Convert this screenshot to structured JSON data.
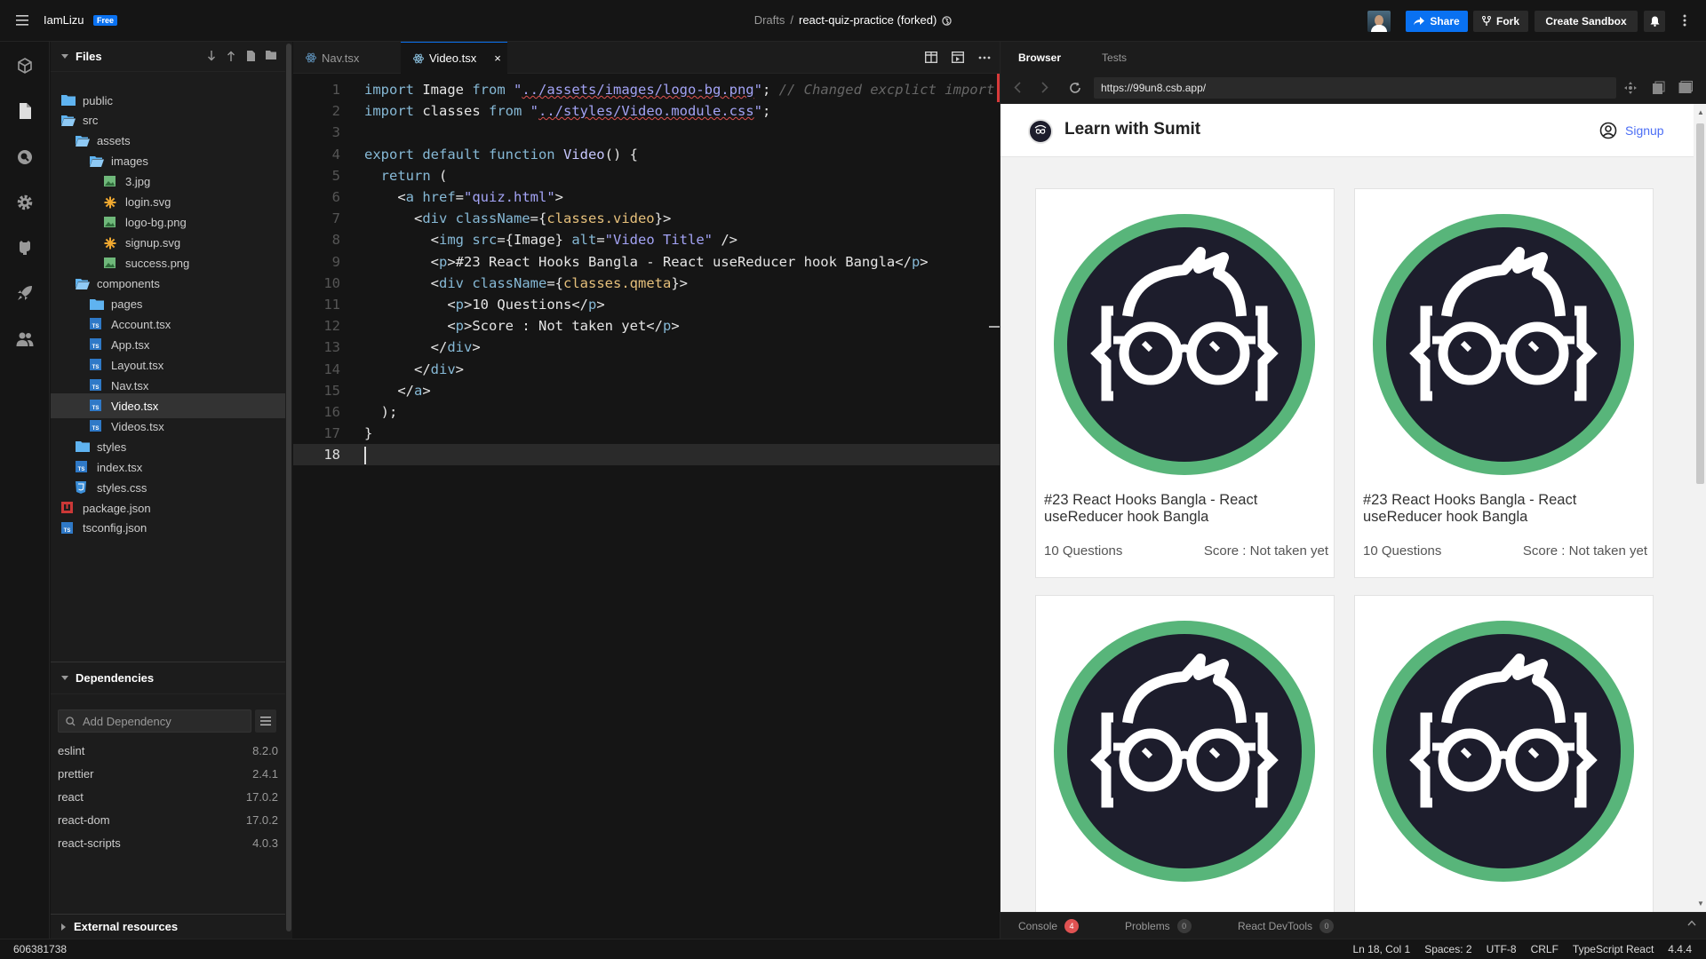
{
  "topbar": {
    "username": "IamLizu",
    "plan_badge": "Free",
    "breadcrumb": {
      "folder": "Drafts",
      "separator": "/",
      "sandbox_name": "react-quiz-practice (forked)"
    },
    "share_label": "Share",
    "fork_label": "Fork",
    "create_label": "Create Sandbox",
    "accent_color": "#0971f1"
  },
  "activity_bar": {
    "icons": [
      "cube-icon",
      "file-icon",
      "search-icon",
      "gear-icon",
      "github-icon",
      "rocket-icon",
      "users-icon"
    ]
  },
  "sidebar": {
    "files_title": "Files",
    "tree": [
      {
        "name": "public",
        "kind": "folder",
        "depth": 0
      },
      {
        "name": "src",
        "kind": "folder-open",
        "depth": 0
      },
      {
        "name": "assets",
        "kind": "folder-open",
        "depth": 1
      },
      {
        "name": "images",
        "kind": "folder-open",
        "depth": 2
      },
      {
        "name": "3.jpg",
        "kind": "image",
        "depth": 3
      },
      {
        "name": "login.svg",
        "kind": "svg",
        "depth": 3
      },
      {
        "name": "logo-bg.png",
        "kind": "image",
        "depth": 3
      },
      {
        "name": "signup.svg",
        "kind": "svg",
        "depth": 3
      },
      {
        "name": "success.png",
        "kind": "image",
        "depth": 3
      },
      {
        "name": "components",
        "kind": "folder-open",
        "depth": 1
      },
      {
        "name": "pages",
        "kind": "folder",
        "depth": 2
      },
      {
        "name": "Account.tsx",
        "kind": "ts",
        "depth": 2
      },
      {
        "name": "App.tsx",
        "kind": "ts",
        "depth": 2
      },
      {
        "name": "Layout.tsx",
        "kind": "ts",
        "depth": 2
      },
      {
        "name": "Nav.tsx",
        "kind": "ts",
        "depth": 2
      },
      {
        "name": "Video.tsx",
        "kind": "ts",
        "depth": 2,
        "active": true
      },
      {
        "name": "Videos.tsx",
        "kind": "ts",
        "depth": 2
      },
      {
        "name": "styles",
        "kind": "folder",
        "depth": 1
      },
      {
        "name": "index.tsx",
        "kind": "ts",
        "depth": 1
      },
      {
        "name": "styles.css",
        "kind": "css",
        "depth": 1
      },
      {
        "name": "package.json",
        "kind": "npm",
        "depth": 0
      },
      {
        "name": "tsconfig.json",
        "kind": "ts",
        "depth": 0
      }
    ],
    "dependencies_title": "Dependencies",
    "dependency_placeholder": "Add Dependency",
    "dependencies": [
      {
        "name": "eslint",
        "version": "8.2.0"
      },
      {
        "name": "prettier",
        "version": "2.4.1"
      },
      {
        "name": "react",
        "version": "17.0.2"
      },
      {
        "name": "react-dom",
        "version": "17.0.2"
      },
      {
        "name": "react-scripts",
        "version": "4.0.3"
      }
    ],
    "external_resources_title": "External resources"
  },
  "editor": {
    "tabs": [
      {
        "label": "Nav.tsx",
        "active": false
      },
      {
        "label": "Video.tsx",
        "active": true
      }
    ],
    "close_glyph": "×",
    "current_line": 18,
    "lines": [
      [
        [
          "k",
          "import "
        ],
        [
          "v",
          "Image "
        ],
        [
          "k",
          "from "
        ],
        [
          "s",
          "\""
        ],
        [
          "sq",
          "../assets/images/logo-bg.png"
        ],
        [
          "s",
          "\""
        ],
        [
          "v",
          "; "
        ],
        [
          "c",
          "// Changed excplict import"
        ]
      ],
      [
        [
          "k",
          "import "
        ],
        [
          "v",
          "classes "
        ],
        [
          "k",
          "from "
        ],
        [
          "s",
          "\""
        ],
        [
          "sq",
          "../styles/Video.module.css"
        ],
        [
          "s",
          "\""
        ],
        [
          "v",
          ";"
        ]
      ],
      [],
      [
        [
          "k",
          "export default function "
        ],
        [
          "f",
          "Video"
        ],
        [
          "v",
          "() {"
        ]
      ],
      [
        [
          "v",
          "  "
        ],
        [
          "k",
          "return "
        ],
        [
          "v",
          "("
        ]
      ],
      [
        [
          "v",
          "    <"
        ],
        [
          "t",
          "a "
        ],
        [
          "a",
          "href"
        ],
        [
          "v",
          "="
        ],
        [
          "s",
          "\"quiz.html\""
        ],
        [
          "v",
          ">"
        ]
      ],
      [
        [
          "v",
          "      <"
        ],
        [
          "t",
          "div "
        ],
        [
          "a",
          "className"
        ],
        [
          "v",
          "={"
        ],
        [
          "y",
          "classes.video"
        ],
        [
          "v",
          "}>"
        ]
      ],
      [
        [
          "v",
          "        <"
        ],
        [
          "t",
          "img "
        ],
        [
          "a",
          "src"
        ],
        [
          "v",
          "={Image} "
        ],
        [
          "a",
          "alt"
        ],
        [
          "v",
          "="
        ],
        [
          "s",
          "\"Video Title\""
        ],
        [
          "v",
          " />"
        ]
      ],
      [
        [
          "v",
          "        <"
        ],
        [
          "t",
          "p"
        ],
        [
          "v",
          ">#23 React Hooks Bangla - React useReducer hook Bangla</"
        ],
        [
          "t",
          "p"
        ],
        [
          "v",
          ">"
        ]
      ],
      [
        [
          "v",
          "        <"
        ],
        [
          "t",
          "div "
        ],
        [
          "a",
          "className"
        ],
        [
          "v",
          "={"
        ],
        [
          "y",
          "classes.qmeta"
        ],
        [
          "v",
          "}>"
        ]
      ],
      [
        [
          "v",
          "          <"
        ],
        [
          "t",
          "p"
        ],
        [
          "v",
          ">10 Questions</"
        ],
        [
          "t",
          "p"
        ],
        [
          "v",
          ">"
        ]
      ],
      [
        [
          "v",
          "          <"
        ],
        [
          "t",
          "p"
        ],
        [
          "v",
          ">Score : Not taken yet</"
        ],
        [
          "t",
          "p"
        ],
        [
          "v",
          ">"
        ]
      ],
      [
        [
          "v",
          "        </"
        ],
        [
          "t",
          "div"
        ],
        [
          "v",
          ">"
        ]
      ],
      [
        [
          "v",
          "      </"
        ],
        [
          "t",
          "div"
        ],
        [
          "v",
          ">"
        ]
      ],
      [
        [
          "v",
          "    </"
        ],
        [
          "t",
          "a"
        ],
        [
          "v",
          ">"
        ]
      ],
      [
        [
          "v",
          "  );"
        ]
      ],
      [
        [
          "v",
          "}"
        ]
      ],
      []
    ]
  },
  "preview": {
    "tabs": [
      {
        "label": "Browser",
        "active": true
      },
      {
        "label": "Tests",
        "active": false
      }
    ],
    "url": "https://99un8.csb.app/",
    "site": {
      "title": "Learn with Sumit",
      "signup": "Signup",
      "cards": [
        {
          "title": "#23 React Hooks Bangla - React useReducer hook Bangla",
          "questions": "10 Questions",
          "score": "Score : Not taken yet"
        },
        {
          "title": "#23 React Hooks Bangla - React useReducer hook Bangla",
          "questions": "10 Questions",
          "score": "Score : Not taken yet"
        },
        {
          "title": "",
          "questions": "",
          "score": ""
        },
        {
          "title": "",
          "questions": "",
          "score": ""
        }
      ]
    },
    "footer": {
      "console_label": "Console",
      "console_count": "4",
      "problems_label": "Problems",
      "problems_count": "0",
      "devtools_label": "React DevTools",
      "devtools_count": "0"
    }
  },
  "statusbar": {
    "sandbox_id": "606381738",
    "position": "Ln 18, Col 1",
    "spaces": "Spaces: 2",
    "encoding": "UTF-8",
    "eol": "CRLF",
    "language": "TypeScript React",
    "version": "4.4.4"
  }
}
